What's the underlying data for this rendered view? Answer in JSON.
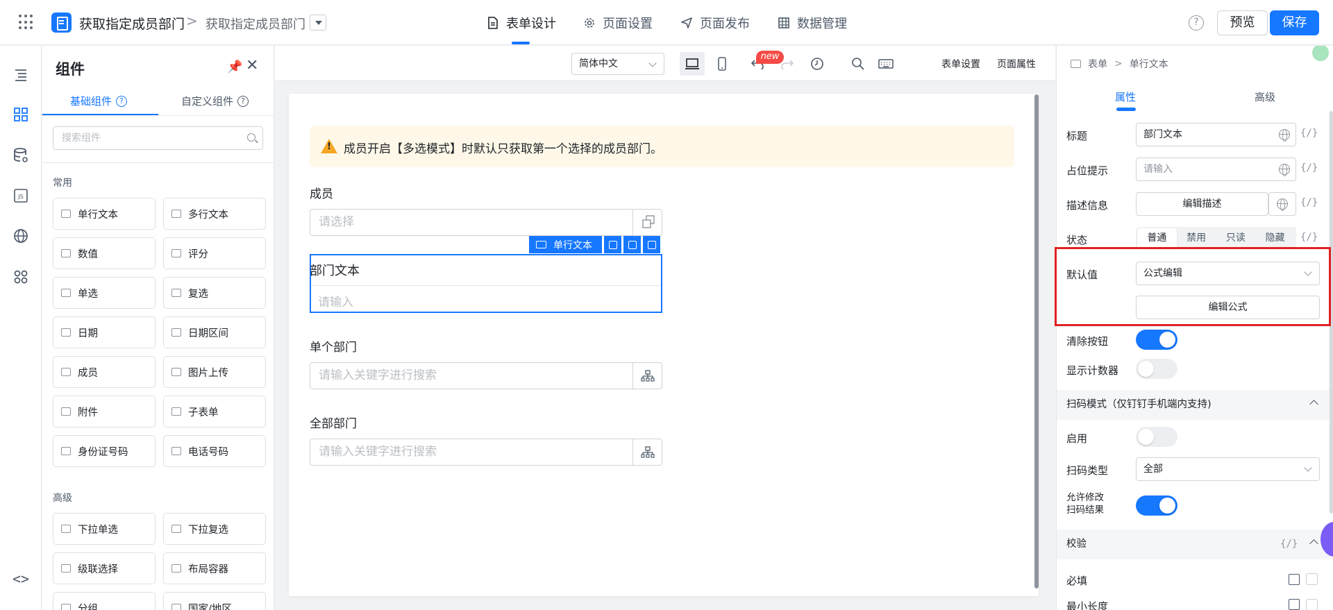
{
  "header": {
    "app_title": "获取指定成员部门",
    "breadcrumb_separator": ">",
    "page_name": "获取指定成员部门",
    "tabs": [
      {
        "label": "表单设计",
        "icon": "form-icon"
      },
      {
        "label": "页面设置",
        "icon": "gear-icon"
      },
      {
        "label": "页面发布",
        "icon": "send-icon"
      },
      {
        "label": "数据管理",
        "icon": "table-icon"
      }
    ],
    "help_symbol": "?",
    "preview_label": "预览",
    "save_label": "保存"
  },
  "rail": {
    "items": [
      "outline-icon",
      "components-icon",
      "datasource-icon",
      "js-icon",
      "globe-icon",
      "apps-icon"
    ],
    "code_symbol": "<>"
  },
  "components_panel": {
    "title": "组件",
    "tabs": [
      {
        "label": "基础组件",
        "active": true
      },
      {
        "label": "自定义组件",
        "active": false
      }
    ],
    "help_symbol": "?",
    "search_placeholder": "搜索组件",
    "sections": [
      {
        "title": "常用",
        "items": [
          "单行文本",
          "多行文本",
          "数值",
          "评分",
          "单选",
          "复选",
          "日期",
          "日期区间",
          "成员",
          "图片上传",
          "附件",
          "子表单",
          "身份证号码",
          "电话号码"
        ]
      },
      {
        "title": "高级",
        "items": [
          "下拉单选",
          "下拉复选",
          "级联选择",
          "布局容器",
          "分组",
          "国家/地区"
        ]
      }
    ]
  },
  "canvas_toolbar": {
    "language": "简体中文",
    "form_settings": "表单设置",
    "page_properties": "页面属性",
    "new_badge": "new"
  },
  "form": {
    "alert": "成员开启【多选模式】时默认只获取第一个选择的成员部门。",
    "fields": [
      {
        "label": "成员",
        "placeholder": "请选择"
      },
      {
        "label": "部门文本",
        "placeholder": "请输入",
        "selected": true
      },
      {
        "label": "单个部门",
        "placeholder": "请输入关键字进行搜索"
      },
      {
        "label": "全部部门",
        "placeholder": "请输入关键字进行搜索"
      }
    ],
    "selected_tag": "单行文本"
  },
  "properties": {
    "breadcrumb": [
      "表单",
      "单行文本"
    ],
    "tabs": [
      "属性",
      "高级"
    ],
    "var_symbol": "{/}",
    "title_label": "标题",
    "title_value": "部门文本",
    "placeholder_label": "占位提示",
    "placeholder_value": "请输入",
    "description_label": "描述信息",
    "description_button": "编辑描述",
    "state_label": "状态",
    "state_options": [
      "普通",
      "禁用",
      "只读",
      "隐藏"
    ],
    "default_label": "默认值",
    "default_mode": "公式编辑",
    "edit_formula_button": "编辑公式",
    "clear_button_label": "清除按钮",
    "clear_button_on": true,
    "counter_label": "显示计数器",
    "counter_on": false,
    "scan_section": "扫码模式（仅钉钉手机端内支持)",
    "enable_label": "启用",
    "enable_on": false,
    "scan_type_label": "扫码类型",
    "scan_type_value": "全部",
    "allow_edit_label_1": "允许修改",
    "allow_edit_label_2": "扫码结果",
    "allow_edit_on": true,
    "validation_section": "校验",
    "required_label": "必填",
    "min_length_label": "最小长度"
  }
}
